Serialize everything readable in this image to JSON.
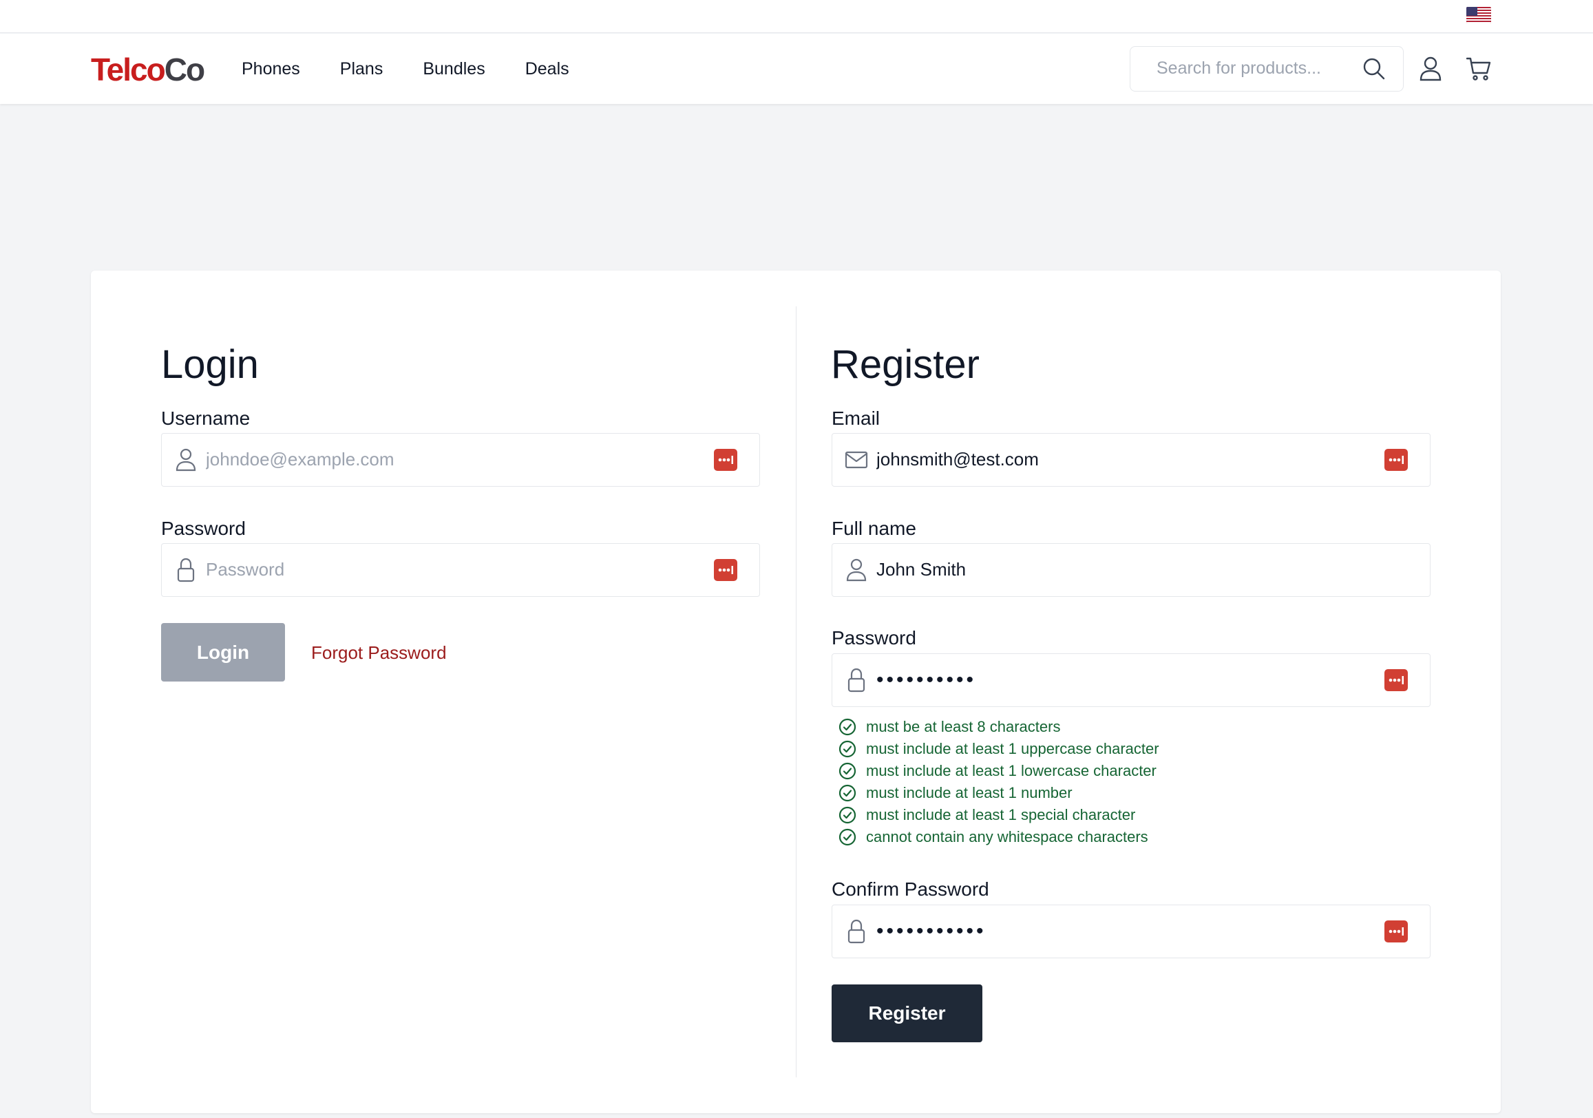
{
  "brand": {
    "logo_part1": "Telco",
    "logo_part2": "Co",
    "accent": "#c81e1e"
  },
  "locale_flag": "us-flag-icon",
  "nav": {
    "items": [
      "Phones",
      "Plans",
      "Bundles",
      "Deals"
    ]
  },
  "search": {
    "placeholder": "Search for products...",
    "value": ""
  },
  "login": {
    "title": "Login",
    "username_label": "Username",
    "username_placeholder": "johndoe@example.com",
    "username_value": "",
    "password_label": "Password",
    "password_placeholder": "Password",
    "password_value": "",
    "submit_label": "Login",
    "forgot_label": "Forgot Password"
  },
  "register": {
    "title": "Register",
    "email_label": "Email",
    "email_value": "johnsmith@test.com",
    "fullname_label": "Full name",
    "fullname_value": "John Smith",
    "password_label": "Password",
    "password_value": "••••••••••",
    "password_rules": [
      "must be at least 8 characters",
      "must include at least 1 uppercase character",
      "must include at least 1 lowercase character",
      "must include at least 1 number",
      "must include at least 1 special character",
      "cannot contain any whitespace characters"
    ],
    "confirm_label": "Confirm Password",
    "confirm_value": "•••••••••••",
    "submit_label": "Register"
  },
  "colors": {
    "rule_ok": "#166534",
    "password_manager": "#d13f33",
    "primary_button": "#1f2937",
    "disabled_button": "#9ca3af"
  }
}
